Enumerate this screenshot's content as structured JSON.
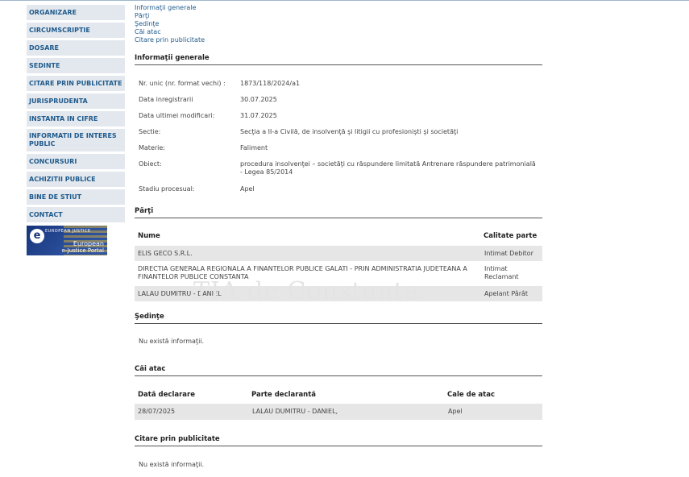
{
  "sidebar": {
    "items": [
      {
        "label": "ORGANIZARE"
      },
      {
        "label": "CIRCUMSCRIPTIE"
      },
      {
        "label": "DOSARE"
      },
      {
        "label": "SEDINTE"
      },
      {
        "label": "CITARE PRIN PUBLICITATE"
      },
      {
        "label": "JURISPRUDENTA"
      },
      {
        "label": "INSTANTA IN CIFRE"
      },
      {
        "label": "INFORMATII DE INTERES PUBLIC"
      },
      {
        "label": "CONCURSURI"
      },
      {
        "label": "ACHIZITII PUBLICE"
      },
      {
        "label": "BINE DE STIUT"
      },
      {
        "label": "CONTACT"
      }
    ],
    "banner": {
      "logo_letter": "e",
      "top_text": "EUROPEAN JUSTICE",
      "title": "European",
      "subtitle": "e-Justice Portal"
    }
  },
  "toc": {
    "links": [
      "Informaţii generale",
      "Părţi",
      "Şedinţe",
      "Căi atac",
      "Citare prin publicitate"
    ]
  },
  "general": {
    "heading": "Informaţii generale",
    "rows": [
      {
        "label": "Nr. unic (nr. format vechi) :",
        "value": "1873/118/2024/a1"
      },
      {
        "label": "Data inregistrarii",
        "value": "30.07.2025"
      },
      {
        "label": "Data ultimei modificari:",
        "value": "31.07.2025"
      },
      {
        "label": "Sectie:",
        "value": "Secţia a II-a Civilă, de insolvenţă şi litigii cu profesionişti şi societăţi"
      },
      {
        "label": "Materie:",
        "value": "Faliment"
      },
      {
        "label": "Obiect:",
        "value": "procedura insolvenţei – societăţi cu răspundere limitată Antrenare răspundere patrimonială - Legea 85/2014"
      },
      {
        "label": "Stadiu procesual:",
        "value": "Apel"
      }
    ]
  },
  "parti": {
    "heading": "Părţi",
    "columns": [
      "Nume",
      "Calitate parte"
    ],
    "rows": [
      {
        "name": "ELIS GECO S.R.L.",
        "role": "Intimat Debitor"
      },
      {
        "name": "DIRECTIA GENERALA REGIONALA A FINANTELOR PUBLICE GALATI - PRIN ADMINISTRATIA JUDETEANA A FINANTELOR PUBLICE CONSTANTA",
        "role": "Intimat Reclamant"
      },
      {
        "name": "LALAU DUMITRU - DANIEL",
        "role": "Apelant Pârât"
      }
    ]
  },
  "sedinte": {
    "heading": "Şedinţe",
    "empty": "Nu există informaţii."
  },
  "cai_atac": {
    "heading": "Căi atac",
    "columns": [
      "Dată declarare",
      "Parte declarantă",
      "Cale de atac"
    ],
    "rows": [
      {
        "date": "28/07/2025",
        "party": "LALAU DUMITRU - DANIEL,",
        "type": "Apel"
      }
    ]
  },
  "citare": {
    "heading": "Citare prin publicitate",
    "empty": "Nu există informaţii."
  },
  "watermark": "TIA de Constanta"
}
